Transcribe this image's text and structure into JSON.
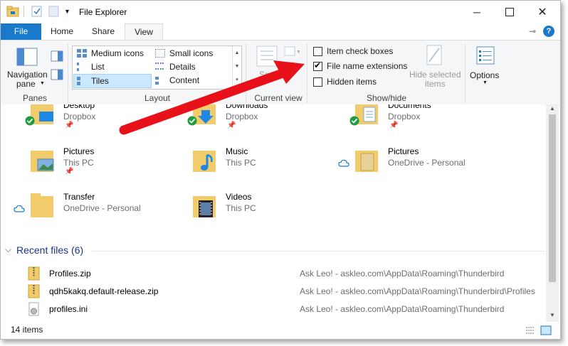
{
  "window": {
    "title": "File Explorer"
  },
  "tabs": [
    {
      "label": "File"
    },
    {
      "label": "Home"
    },
    {
      "label": "Share"
    },
    {
      "label": "View"
    }
  ],
  "ribbon": {
    "panes": {
      "nav_pane_line1": "Navigation",
      "nav_pane_line2": "pane",
      "group": "Panes"
    },
    "layout": {
      "group": "Layout",
      "items": [
        "Medium icons",
        "Small icons",
        "List",
        "Details",
        "Tiles",
        "Content"
      ],
      "selected": "Tiles"
    },
    "current_view": {
      "sort": "Sort",
      "group": "Current view"
    },
    "show_hide": {
      "group": "Show/hide",
      "item_check_boxes": "Item check boxes",
      "file_name_extensions": "File name extensions",
      "hidden_items": "Hidden items",
      "hide_selected_line1": "Hide selected",
      "hide_selected_line2": "items",
      "item_check_boxes_checked": false,
      "file_name_extensions_checked": true,
      "hidden_items_checked": false
    },
    "options": {
      "label": "Options"
    }
  },
  "folders": [
    {
      "name": "Desktop",
      "sub": "Dropbox"
    },
    {
      "name": "Downloads",
      "sub": "Dropbox"
    },
    {
      "name": "Documents",
      "sub": "Dropbox"
    },
    {
      "name": "Pictures",
      "sub": "This PC"
    },
    {
      "name": "Music",
      "sub": "This PC"
    },
    {
      "name": "Pictures",
      "sub": "OneDrive - Personal"
    },
    {
      "name": "Transfer",
      "sub": "OneDrive - Personal"
    },
    {
      "name": "Videos",
      "sub": "This PC"
    }
  ],
  "recent": {
    "header": "Recent files (6)",
    "files": [
      {
        "name": "Profiles.zip",
        "path": "Ask Leo! - askleo.com\\AppData\\Roaming\\Thunderbird"
      },
      {
        "name": "qdh5kakq.default-release.zip",
        "path": "Ask Leo! - askleo.com\\AppData\\Roaming\\Thunderbird\\Profiles"
      },
      {
        "name": "profiles.ini",
        "path": "Ask Leo! - askleo.com\\AppData\\Roaming\\Thunderbird"
      }
    ]
  },
  "status": {
    "items": "14 items"
  },
  "colors": {
    "file_tab": "#1979ca",
    "folder": "#f2cc6a",
    "arrow": "#e8111a",
    "sync_green": "#1e9e3e",
    "help_blue": "#1979ca"
  }
}
